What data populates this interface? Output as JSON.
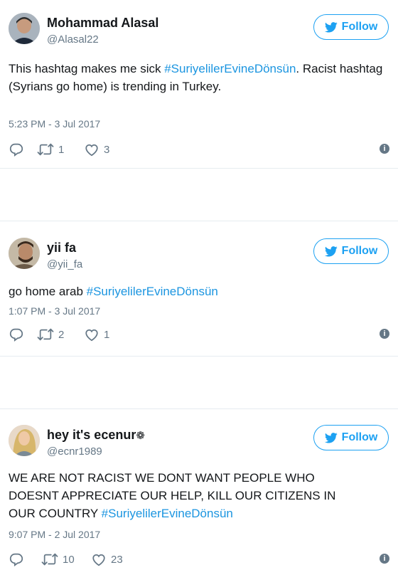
{
  "tweets": [
    {
      "name": "Mohammad Alasal",
      "name_suffix": "",
      "handle": "@Alasal22",
      "follow_label": "Follow",
      "text_before": "This hashtag makes me sick ",
      "hashtag": "#SuriyelilerEvineDönsün",
      "text_after": ". Racist hashtag",
      "text_line2": "(Syrians go home) is trending in Turkey.",
      "time": "5:23 PM - 3 Jul 2017",
      "retweets": "1",
      "likes": "3",
      "avatar_icon": "user-avatar-icon"
    },
    {
      "name": "yii fa",
      "name_suffix": "",
      "handle": "@yii_fa",
      "follow_label": "Follow",
      "text_before": "go home arab ",
      "hashtag": "#SuriyelilerEvineDönsün",
      "time": "1:07 PM - 3 Jul 2017",
      "retweets": "2",
      "likes": "1",
      "avatar_icon": "user-avatar-icon"
    },
    {
      "name": "hey it's ecenur",
      "name_suffix": "❁",
      "handle": "@ecnr1989",
      "follow_label": "Follow",
      "text_line1": "WE ARE NOT RACIST WE DONT WANT PEOPLE WHO",
      "text_line2": "DOESNT APPRECIATE OUR HELP, KILL OUR CITIZENS IN",
      "text_before3": "OUR COUNTRY ",
      "hashtag": "#SuriyelilerEvineDönsün",
      "time": "9:07 PM - 2 Jul 2017",
      "retweets": "10",
      "likes": "23",
      "avatar_icon": "user-avatar-icon"
    }
  ],
  "colors": {
    "accent": "#1da1f2",
    "hashtag": "#1b95e0",
    "muted": "#657786",
    "divider": "#e6ecf0"
  },
  "icons": [
    "twitter-bird-icon",
    "reply-icon",
    "retweet-icon",
    "like-icon",
    "info-icon"
  ]
}
